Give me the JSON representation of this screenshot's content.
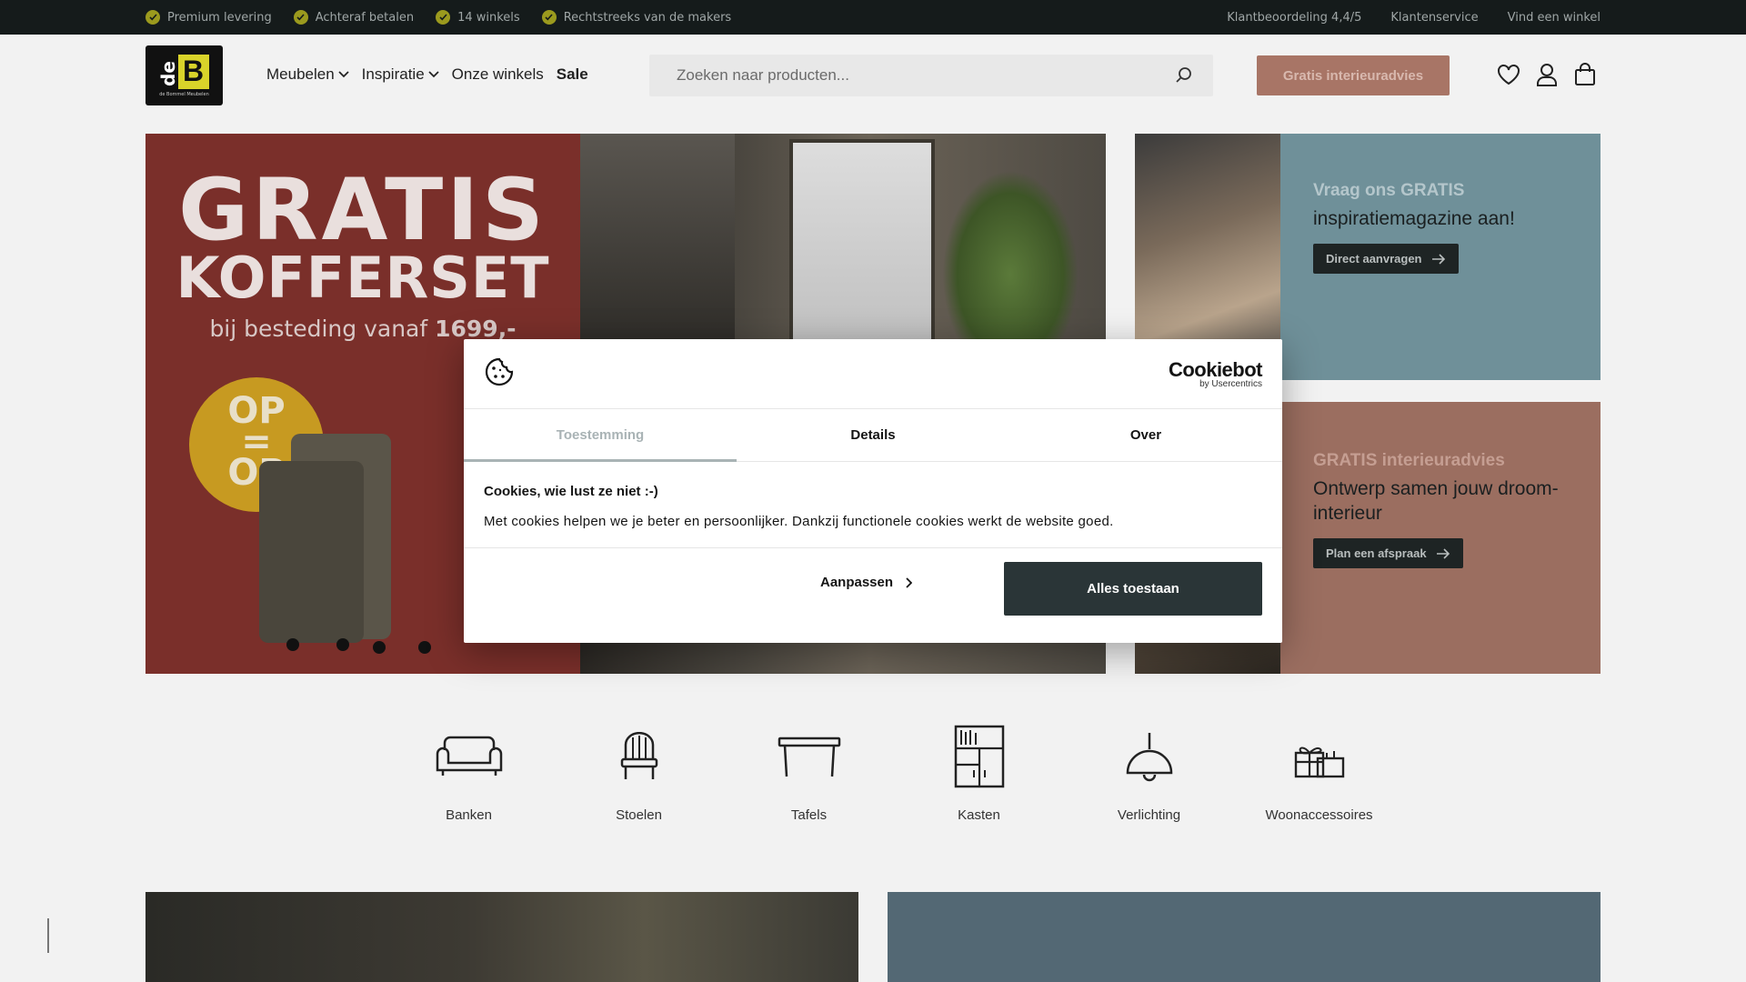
{
  "topbar": {
    "usps": [
      "Premium levering",
      "Achteraf betalen",
      "14 winkels",
      "Rechtstreeks van de makers"
    ],
    "links": [
      "Klantbeoordeling 4,4/5",
      "Klantenservice",
      "Vind een winkel"
    ]
  },
  "header": {
    "logo_text": "de B",
    "logo_tagline": "de Bommel Meubelen",
    "nav": [
      "Meubelen",
      "Inspiratie",
      "Onze winkels",
      "Sale"
    ],
    "search_placeholder": "Zoeken naar producten...",
    "cta": "Gratis interieuradvies"
  },
  "hero": {
    "line1": "GRATIS",
    "line2": "KOFFERSET",
    "line3_prefix": "bij besteding vanaf ",
    "line3_amount": "1699,-",
    "badge": [
      "OP",
      "=",
      "OP"
    ]
  },
  "side_banners": [
    {
      "head": "Vraag ons GRATIS",
      "sub": "inspiratiemagazine aan!",
      "button": "Direct aanvragen"
    },
    {
      "head": "GRATIS interieuradvies",
      "sub": "Ontwerp samen jouw droom-interieur",
      "button": "Plan een afspraak"
    }
  ],
  "categories": [
    {
      "label": "Banken",
      "icon": "sofa-icon"
    },
    {
      "label": "Stoelen",
      "icon": "chair-icon"
    },
    {
      "label": "Tafels",
      "icon": "table-icon"
    },
    {
      "label": "Kasten",
      "icon": "cabinet-icon"
    },
    {
      "label": "Verlichting",
      "icon": "lamp-icon"
    },
    {
      "label": "Woonaccessoires",
      "icon": "accessories-icon"
    }
  ],
  "cookie_dialog": {
    "brand": "Cookiebot",
    "brand_sub": "by Usercentrics",
    "tabs": [
      "Toestemming",
      "Details",
      "Over"
    ],
    "active_tab": "Toestemming",
    "title": "Cookies, wie lust ze niet :-)",
    "text": "Met cookies helpen we je beter en persoonlijker. Dankzij functionele cookies werkt de website goed.",
    "customize": "Aanpassen",
    "allow_all": "Alles toestaan"
  },
  "colors": {
    "topbar_bg": "#151b1b",
    "check_green": "#9b9a1e",
    "hero_red": "#7a2f2a",
    "side_blue": "#6f9099",
    "side_brown": "#9b6e60",
    "allow_button": "#2a3537"
  }
}
